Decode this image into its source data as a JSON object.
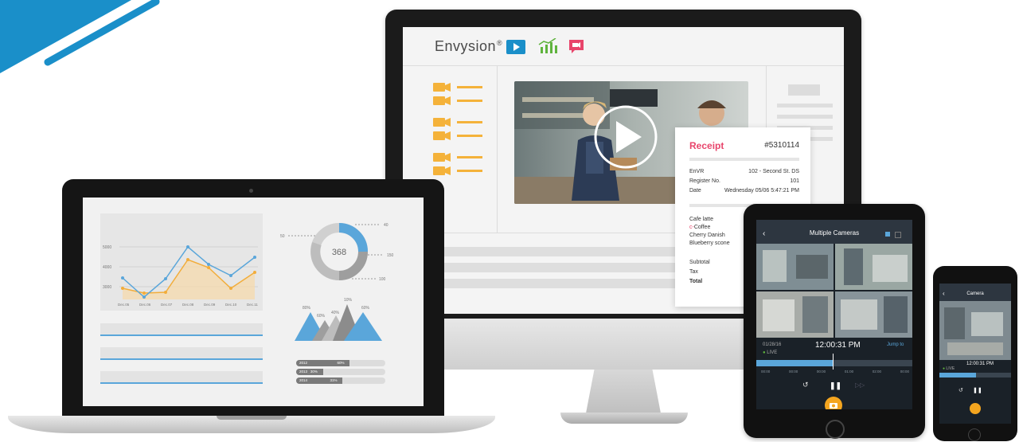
{
  "colors": {
    "brand_blue": "#1a8fc9",
    "accent_orange": "#f4a51f",
    "receipt_pink": "#e8456b",
    "chart_blue": "#5aa6da",
    "chart_orange": "#f2ad3b"
  },
  "imac": {
    "brand": "Envysion",
    "brand_mark": "®",
    "toolbar_icons": [
      "video-play-icon",
      "analytics-chart-icon",
      "chat-camera-icon"
    ],
    "receipt": {
      "title": "Receipt",
      "number": "#5310114",
      "rows": [
        {
          "label": "EnVR",
          "value": "102 - Second St. DS"
        },
        {
          "label": "Register No.",
          "value": "101"
        },
        {
          "label": "Date",
          "value": "Wednesday 05/06 5:47:21 PM"
        }
      ],
      "items": [
        "Cafe latte",
        "Coffee",
        "Cherry Danish",
        "Blueberry scone"
      ],
      "totals": [
        "Subtotal",
        "Tax",
        "Total"
      ]
    }
  },
  "laptop": {
    "line_chart": {
      "y_ticks": [
        "5000",
        "4000",
        "3000"
      ],
      "x_ticks": [
        "Dec.05",
        "Dec.06",
        "Dec.07",
        "Dec.08",
        "Dec.09",
        "Dec.10",
        "Dec.11"
      ]
    },
    "donut": {
      "center": "368",
      "labels": [
        "50",
        "40",
        "150",
        "100"
      ]
    },
    "mountain": {
      "labels": [
        "80%",
        "60%",
        "40%",
        "10%",
        "60%"
      ]
    },
    "progress_rows": [
      {
        "label": "2012",
        "value": "60%",
        "fill": 0.6
      },
      {
        "label": "2013",
        "value": "30%",
        "fill": 0.3
      },
      {
        "label": "2014",
        "value": "31%",
        "fill": 0.52
      }
    ]
  },
  "tablet": {
    "title": "Multiple Cameras",
    "date": "01/28/16",
    "live": "LIVE",
    "time": "12:00:31 PM",
    "jump": "Jump to",
    "timeline_ticks": [
      "00:00",
      "00:00",
      "00:00",
      "01:00",
      "02:00",
      "00:00"
    ]
  },
  "phone": {
    "title": "Camera",
    "live": "LIVE",
    "time": "12:00:31 PM"
  }
}
